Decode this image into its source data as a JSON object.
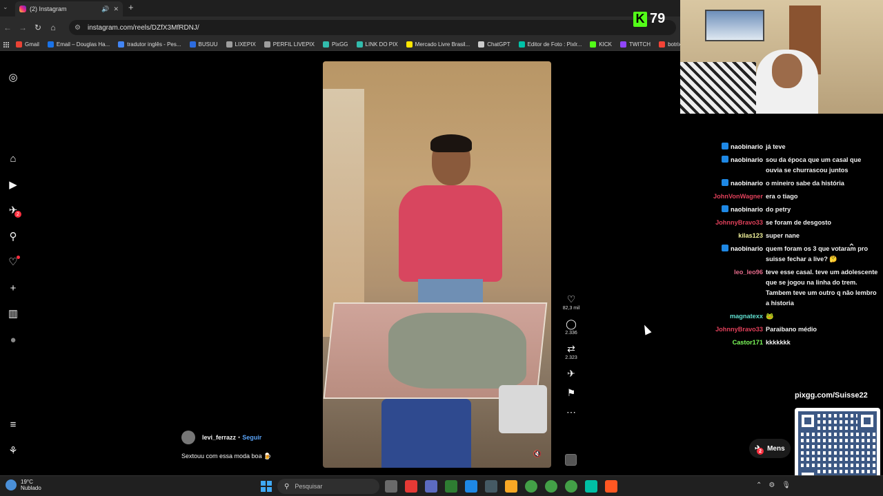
{
  "browser": {
    "tab_title": "(2) Instagram",
    "url": "instagram.com/reels/DZfX3MfRDNJ/",
    "bookmarks": [
      {
        "label": "Gmail",
        "color": "#ea4335"
      },
      {
        "label": "Email – Douglas Ha...",
        "color": "#1a73e8"
      },
      {
        "label": "tradutor inglês - Pes...",
        "color": "#4285f4"
      },
      {
        "label": "BUSUU",
        "color": "#2d6cdf"
      },
      {
        "label": "LIXEPIX",
        "color": "#9e9e9e"
      },
      {
        "label": "PERFIL LIVEPIX",
        "color": "#9e9e9e"
      },
      {
        "label": "PixGG",
        "color": "#32bcad"
      },
      {
        "label": "LINK DO PIX",
        "color": "#32bcad"
      },
      {
        "label": "Mercado Livre Brasil...",
        "color": "#ffe600"
      },
      {
        "label": "ChatGPT",
        "color": "#cccccc"
      },
      {
        "label": "Editor de Foto : Pixlr...",
        "color": "#00c2a8"
      },
      {
        "label": "KICK",
        "color": "#53fc18"
      },
      {
        "label": "TWITCH",
        "color": "#9146ff"
      },
      {
        "label": "botrix",
        "color": "#f44336"
      }
    ]
  },
  "sidebar": {
    "icons": [
      {
        "name": "instagram-logo-icon",
        "glyph": "◎"
      },
      {
        "name": "home-icon",
        "glyph": "⌂"
      },
      {
        "name": "reels-icon",
        "glyph": "▶"
      },
      {
        "name": "messages-icon",
        "glyph": "✈",
        "badge": "2"
      },
      {
        "name": "search-icon",
        "glyph": "⚲"
      },
      {
        "name": "notifications-icon",
        "glyph": "♡"
      },
      {
        "name": "create-icon",
        "glyph": "+"
      },
      {
        "name": "dashboard-icon",
        "glyph": "▥"
      },
      {
        "name": "profile-icon",
        "glyph": "●"
      },
      {
        "name": "more-menu-icon",
        "glyph": "≡"
      },
      {
        "name": "also-from-meta-icon",
        "glyph": "⚘"
      }
    ]
  },
  "reel": {
    "likes": "82,3 mil",
    "comments": "2.336",
    "reposts": "2.323",
    "author": "levi_ferrazz",
    "separator": "•",
    "follow_label": "Seguir",
    "caption": "Sextouu com essa moda boa 🍺"
  },
  "overlay": {
    "kick_score": "79",
    "pix_url": "pixgg.com/Suisse22",
    "messages_label": "Mens",
    "messages_badge": "2"
  },
  "chat": [
    {
      "user": "naobinario",
      "color": "#ffffff",
      "badge": true,
      "text": "já teve"
    },
    {
      "user": "naobinario",
      "color": "#ffffff",
      "badge": true,
      "text": "sou da época que um casal que ouvia se churrascou juntos"
    },
    {
      "user": "naobinario",
      "color": "#ffffff",
      "badge": true,
      "text": "o mineiro sabe da história"
    },
    {
      "user": "JohnVonWagner",
      "color": "#e0405a",
      "badge": false,
      "text": "era o tiago"
    },
    {
      "user": "naobinario",
      "color": "#ffffff",
      "badge": true,
      "text": "do petry"
    },
    {
      "user": "JohnnyBravo33",
      "color": "#e0405a",
      "badge": false,
      "text": "se foram de desgosto"
    },
    {
      "user": "kilas123",
      "color": "#f2f29a",
      "badge": false,
      "text": "super nane"
    },
    {
      "user": "naobinario",
      "color": "#ffffff",
      "badge": true,
      "text": "quem foram os 3 que votaram pro suisse fechar a live? 🤔"
    },
    {
      "user": "leo_leo96",
      "color": "#e46a8a",
      "badge": false,
      "text": "teve esse casal. teve um adolescente que se jogou na linha do trem. Tambem teve um outro q não lembro a historia"
    },
    {
      "user": "magnatexx",
      "color": "#60e0d0",
      "badge": false,
      "text": "🐸"
    },
    {
      "user": "JohnnyBravo33",
      "color": "#e0405a",
      "badge": false,
      "text": "Paraibano médio"
    },
    {
      "user": "Castor171",
      "color": "#7cfc5a",
      "badge": false,
      "text": "kkkkkkk"
    }
  ],
  "taskbar": {
    "temperature": "19°C",
    "weather": "Nublado",
    "search_placeholder": "Pesquisar"
  }
}
